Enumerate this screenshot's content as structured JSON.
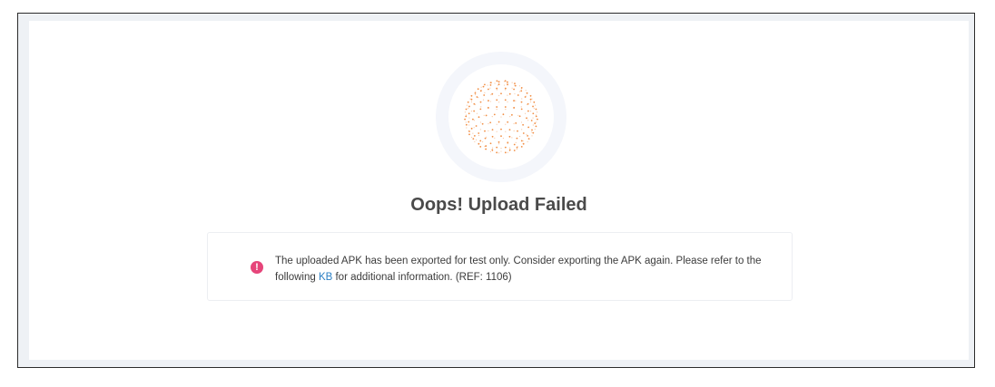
{
  "title": "Oops! Upload Failed",
  "error": {
    "icon": "exclamation-circle-icon",
    "icon_glyph": "!",
    "message_before_link": "The uploaded APK has been exported for test only. Consider exporting the APK again. Please refer to the following ",
    "link_label": "KB",
    "message_after_link": " for additional information. (REF: 1106)"
  },
  "illustration": {
    "icon": "dotted-globe-icon"
  },
  "colors": {
    "globe_dots": "#f0883a",
    "error_icon": "#e6457a",
    "link": "#2b7fc4",
    "title": "#4a4a4a"
  }
}
